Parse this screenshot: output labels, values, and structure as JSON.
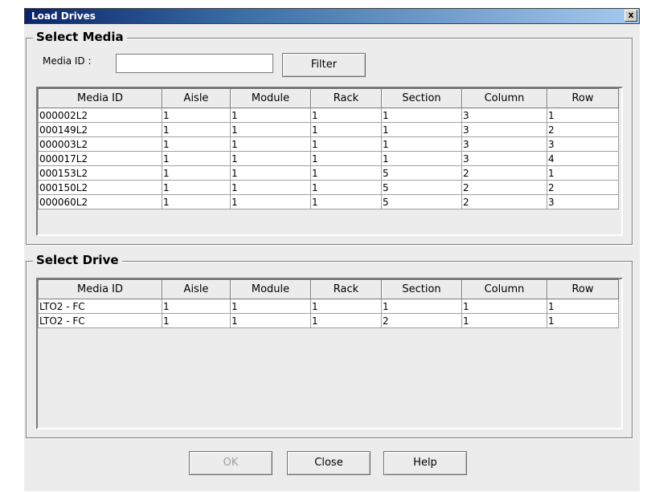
{
  "window": {
    "title": "Load Drives",
    "close_label": "x"
  },
  "select_media": {
    "title": "Select Media",
    "media_id_label": "Media ID :",
    "media_id_value": "",
    "filter_label": "Filter",
    "columns": [
      "Media ID",
      "Aisle",
      "Module",
      "Rack",
      "Section",
      "Column",
      "Row"
    ],
    "rows": [
      [
        "000002L2",
        "1",
        "1",
        "1",
        "1",
        "3",
        "1"
      ],
      [
        "000149L2",
        "1",
        "1",
        "1",
        "1",
        "3",
        "2"
      ],
      [
        "000003L2",
        "1",
        "1",
        "1",
        "1",
        "3",
        "3"
      ],
      [
        "000017L2",
        "1",
        "1",
        "1",
        "1",
        "3",
        "4"
      ],
      [
        "000153L2",
        "1",
        "1",
        "1",
        "5",
        "2",
        "1"
      ],
      [
        "000150L2",
        "1",
        "1",
        "1",
        "5",
        "2",
        "2"
      ],
      [
        "000060L2",
        "1",
        "1",
        "1",
        "5",
        "2",
        "3"
      ]
    ]
  },
  "select_drive": {
    "title": "Select Drive",
    "columns": [
      "Media ID",
      "Aisle",
      "Module",
      "Rack",
      "Section",
      "Column",
      "Row"
    ],
    "rows": [
      [
        "LTO2 - FC",
        "1",
        "1",
        "1",
        "1",
        "1",
        "1"
      ],
      [
        "LTO2 - FC",
        "1",
        "1",
        "1",
        "2",
        "1",
        "1"
      ]
    ]
  },
  "buttons": {
    "ok": "OK",
    "close": "Close",
    "help": "Help"
  }
}
